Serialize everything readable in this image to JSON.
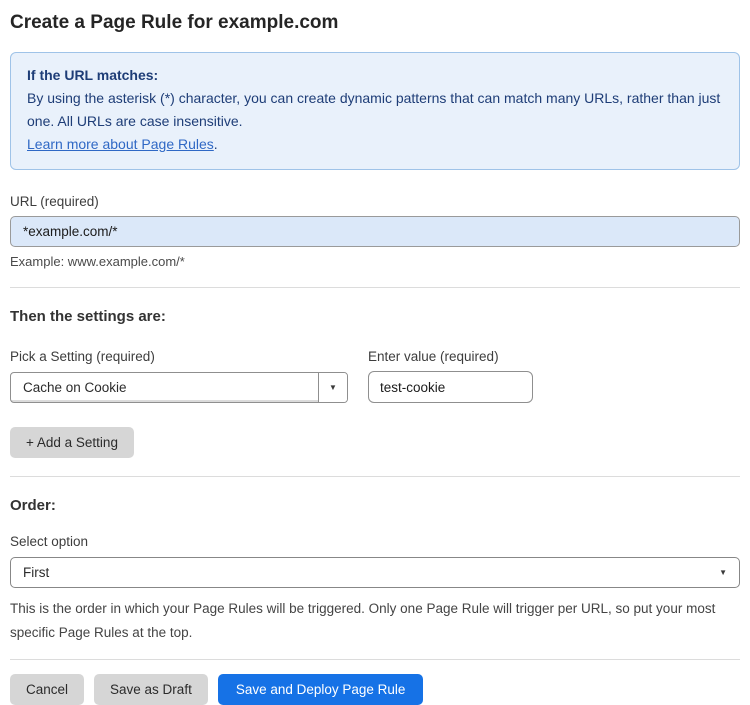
{
  "page": {
    "title": "Create a Page Rule for example.com"
  },
  "info_box": {
    "heading": "If the URL matches:",
    "body": "By using the asterisk (*) character, you can create dynamic patterns that can match many URLs, rather than just one. All URLs are case insensitive.",
    "link_label": "Learn more about Page Rules",
    "link_suffix": "."
  },
  "url_field": {
    "label": "URL (required)",
    "value": "*example.com/*",
    "example": "Example: www.example.com/*"
  },
  "settings_section": {
    "heading": "Then the settings are:",
    "setting_select": {
      "label": "Pick a Setting (required)",
      "value": "Cache on Cookie"
    },
    "value_field": {
      "label": "Enter value (required)",
      "value": "test-cookie"
    },
    "add_setting_label": "+ Add a Setting"
  },
  "order_section": {
    "heading": "Order:",
    "select_label": "Select option",
    "selected_option": "First",
    "help_text": "This is the order in which your Page Rules will be triggered. Only one Page Rule will trigger per URL, so put your most specific Page Rules at the top."
  },
  "footer": {
    "cancel_label": "Cancel",
    "save_draft_label": "Save as Draft",
    "save_deploy_label": "Save and Deploy Page Rule"
  },
  "icons": {
    "dropdown_caret": "▼"
  },
  "colors": {
    "info_box_background": "#e9f1fb",
    "info_box_border": "#9fc3e8",
    "info_box_text": "#1e3d77",
    "link_blue": "#2f68c5",
    "url_input_background": "#dbe8f9",
    "primary_button_blue": "#1672e6",
    "gray_button": "#d6d6d6"
  }
}
